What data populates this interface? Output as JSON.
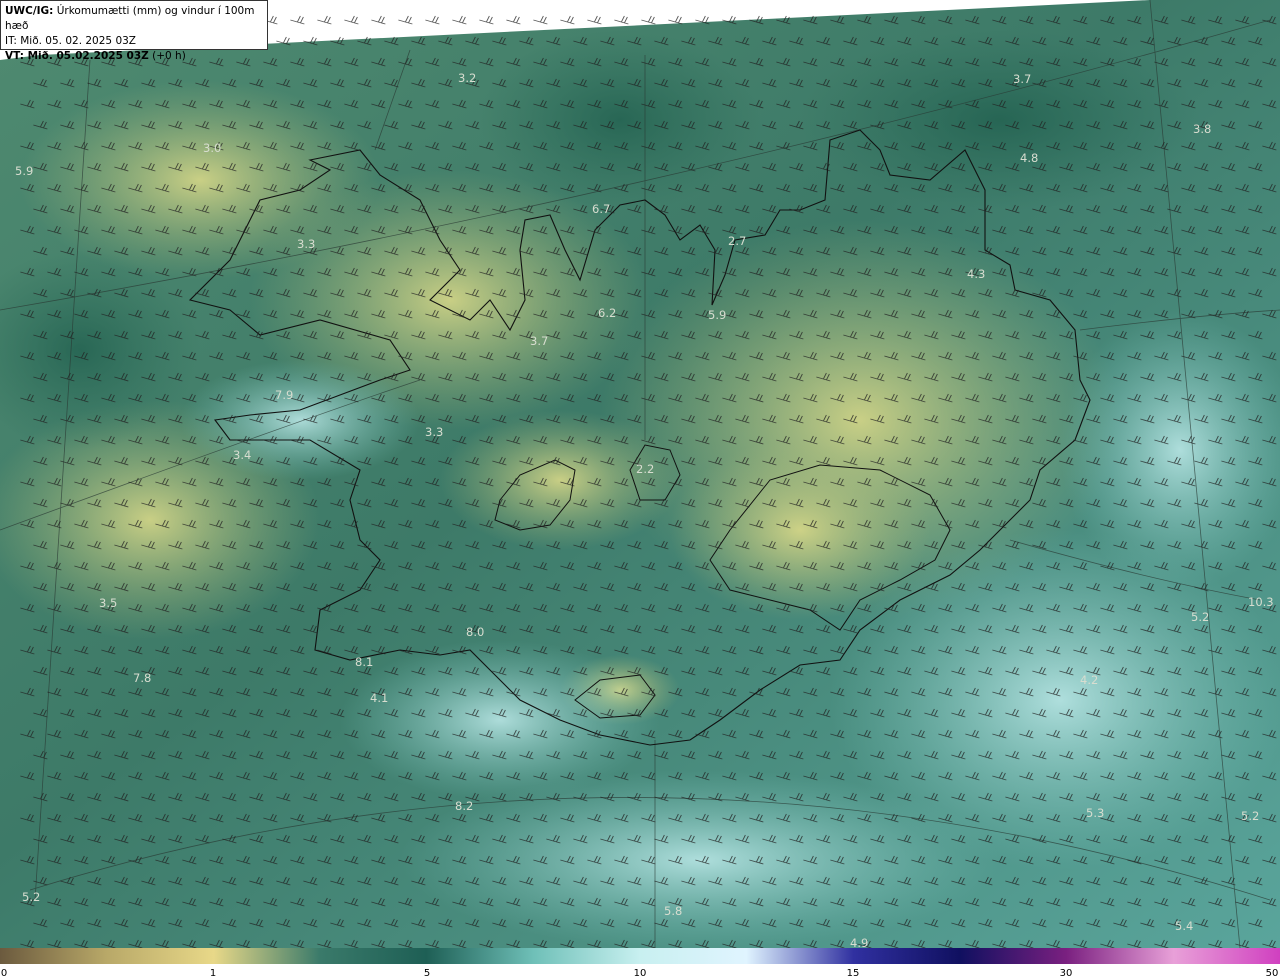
{
  "header": {
    "product": "UWC/IG:",
    "title": "Úrkomumætti (mm) og vindur í 100m hæð",
    "it_line": "IT: Mið. 05. 02. 2025 03Z",
    "vt_label": "VT: Mið. 05.02.2025 03Z",
    "vt_offset": "(+0 h)"
  },
  "map_labels": [
    {
      "text": "3.2"
    },
    {
      "text": "3.7"
    },
    {
      "text": "3.8"
    },
    {
      "text": "3.0"
    },
    {
      "text": "5.9"
    },
    {
      "text": "4.8"
    },
    {
      "text": "6.7"
    },
    {
      "text": "2.7"
    },
    {
      "text": "3.3"
    },
    {
      "text": "4.3"
    },
    {
      "text": "6.2"
    },
    {
      "text": "5.9"
    },
    {
      "text": "3.7"
    },
    {
      "text": "7.9"
    },
    {
      "text": "3.3"
    },
    {
      "text": "3.4"
    },
    {
      "text": "2.2"
    },
    {
      "text": "3.5"
    },
    {
      "text": "8.0"
    },
    {
      "text": "5.2"
    },
    {
      "text": "8.1"
    },
    {
      "text": "7.8"
    },
    {
      "text": "4.1"
    },
    {
      "text": "4.2"
    },
    {
      "text": "8.2"
    },
    {
      "text": "5.3"
    },
    {
      "text": "5.2"
    },
    {
      "text": "5.2"
    },
    {
      "text": "5.8"
    },
    {
      "text": "5.4"
    },
    {
      "text": "4.9"
    },
    {
      "text": "10.3"
    }
  ],
  "colorbar": {
    "ticks": [
      "0",
      "1",
      "5",
      "10",
      "15",
      "30",
      "50"
    ],
    "colors": [
      "#6b5a3e",
      "#b8a868",
      "#e8d888",
      "#3a7a6a",
      "#1e5f55",
      "#6fc0b8",
      "#c8f0f0",
      "#e0f4ff",
      "#3030a0",
      "#101060",
      "#7a2080",
      "#e8a0d8",
      "#d040c0"
    ]
  }
}
